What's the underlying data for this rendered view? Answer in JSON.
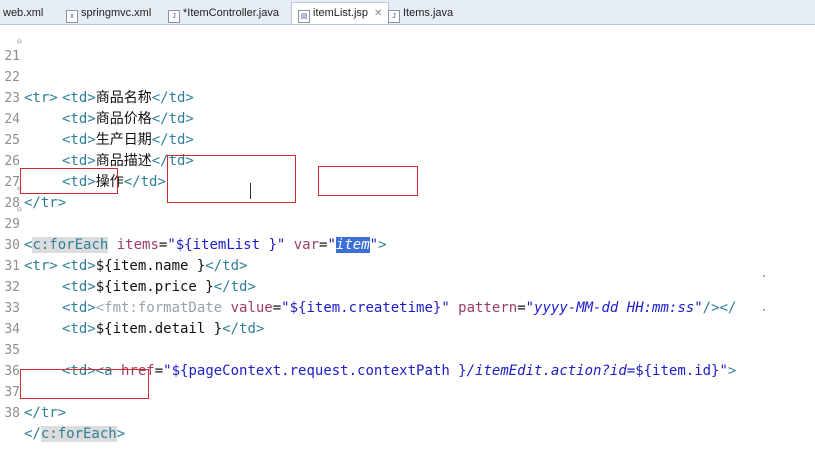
{
  "tabs": [
    {
      "name": "web.xml",
      "icon": "xml-file-icon",
      "active": false
    },
    {
      "name": "springmvc.xml",
      "icon": "xml-file-icon",
      "active": false
    },
    {
      "name": "*ItemController.java",
      "icon": "java-file-icon",
      "active": false
    },
    {
      "name": "itemList.jsp",
      "icon": "jsp-file-icon",
      "active": true,
      "close": "✕"
    },
    {
      "name": "Items.java",
      "icon": "java-file-icon",
      "active": false
    }
  ],
  "lines": {
    "l21": {
      "num": "21",
      "tag_open": "<tr>"
    },
    "l22": {
      "num": "22",
      "open": "<td>",
      "text": "商品名称",
      "close": "</td>"
    },
    "l23": {
      "num": "23",
      "open": "<td>",
      "text": "商品价格",
      "close": "</td>"
    },
    "l24": {
      "num": "24",
      "open": "<td>",
      "text": "生产日期",
      "close": "</td>"
    },
    "l25": {
      "num": "25",
      "open": "<td>",
      "text": "商品描述",
      "close": "</td>"
    },
    "l26": {
      "num": "26",
      "open": "<td>",
      "text": "操作",
      "close": "</td>"
    },
    "l27": {
      "num": "27",
      "tag": "</tr>"
    },
    "l28": {
      "num": "28",
      "lt": "<",
      "tagname": "c:forEach",
      "attr1": " items",
      "eq1": "=",
      "val1": "\"${itemList }\"",
      "attr2": " var",
      "eq2": "=",
      "q_open": "\"",
      "val2": "item",
      "q_close": "\"",
      "gt": ">"
    },
    "l29": {
      "num": "29",
      "tag": "<tr>"
    },
    "l30": {
      "num": "30",
      "open": "<td>",
      "text": "${item.name }",
      "close": "</td>"
    },
    "l31": {
      "num": "31",
      "open": "<td>",
      "text": "${item.price }",
      "close": "</td>"
    },
    "l32": {
      "num": "32",
      "open": "<td>",
      "tag2": "<fmt:formatDate",
      "attr1": " value",
      "eq1": "=",
      "val1": "\"${item.createtime}\"",
      "attr2": " pattern",
      "eq2": "=",
      "val2": "\"yyyy-MM-dd HH:mm:ss\"",
      "end": "/></"
    },
    "l33": {
      "num": "33",
      "open": "<td>",
      "text": "${item.detail }",
      "close": "</td>"
    },
    "l34": {
      "num": "34"
    },
    "l35": {
      "num": "35",
      "open": "<td>",
      "tag2": "<a",
      "attr1": " href",
      "eq1": "=",
      "val1": "\"${pageContext.request.contextPath }",
      "val1i": "/itemEdit.action?id=",
      "val1b": "${item.id}\"",
      "end": ">"
    },
    "l36": {
      "num": "36"
    },
    "l37": {
      "num": "37",
      "tag": "</tr>"
    },
    "l38": {
      "num": "38",
      "lt": "</",
      "tagname": "c:forEach",
      "gt": ">"
    }
  }
}
